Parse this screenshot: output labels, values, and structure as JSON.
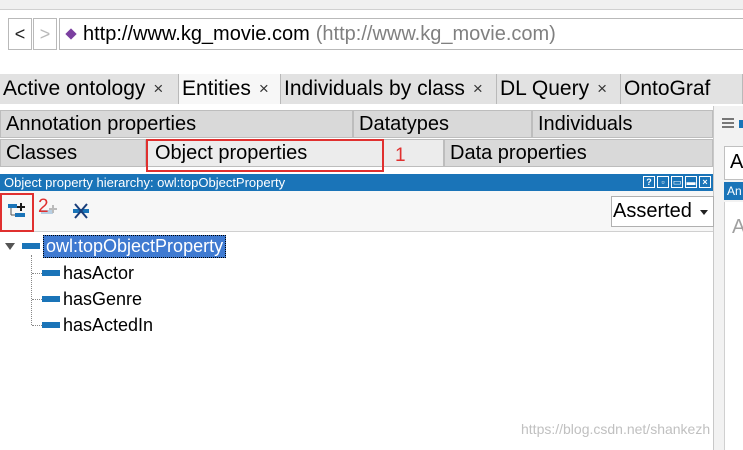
{
  "address_bar": {
    "back_label": "<",
    "forward_label": ">",
    "url": "http://www.kg_movie.com",
    "url_full": "(http://www.kg_movie.com)"
  },
  "main_tabs": [
    {
      "label": "Active ontology",
      "close": "×",
      "active": false
    },
    {
      "label": "Entities",
      "close": "×",
      "active": true
    },
    {
      "label": "Individuals by class",
      "close": "×",
      "active": false
    },
    {
      "label": "DL Query",
      "close": "×",
      "active": false
    },
    {
      "label": "OntoGraf",
      "close": "",
      "active": false
    }
  ],
  "sub_tabs_row1": [
    "Annotation properties",
    "Datatypes",
    "Individuals"
  ],
  "sub_tabs_row2": [
    "Classes",
    "Object properties",
    "Data properties"
  ],
  "hierarchy": {
    "title": "Object property hierarchy: owl:topObjectProperty",
    "controls": [
      "?",
      "▫",
      "▭",
      "▬",
      "×"
    ],
    "mode": "Asserted",
    "root": "owl:topObjectProperty",
    "children": [
      "hasActor",
      "hasGenre",
      "hasActedIn"
    ]
  },
  "side_panel": {
    "letter": "A",
    "bar_text": "An",
    "letter2": "A"
  },
  "annotations": {
    "num1": "1",
    "num2": "2"
  },
  "watermark": "https://blog.csdn.net/shankezh",
  "colors": {
    "accent_blue": "#1a74b8",
    "selection": "#3f7ad1",
    "annotation_red": "#e0302f"
  }
}
